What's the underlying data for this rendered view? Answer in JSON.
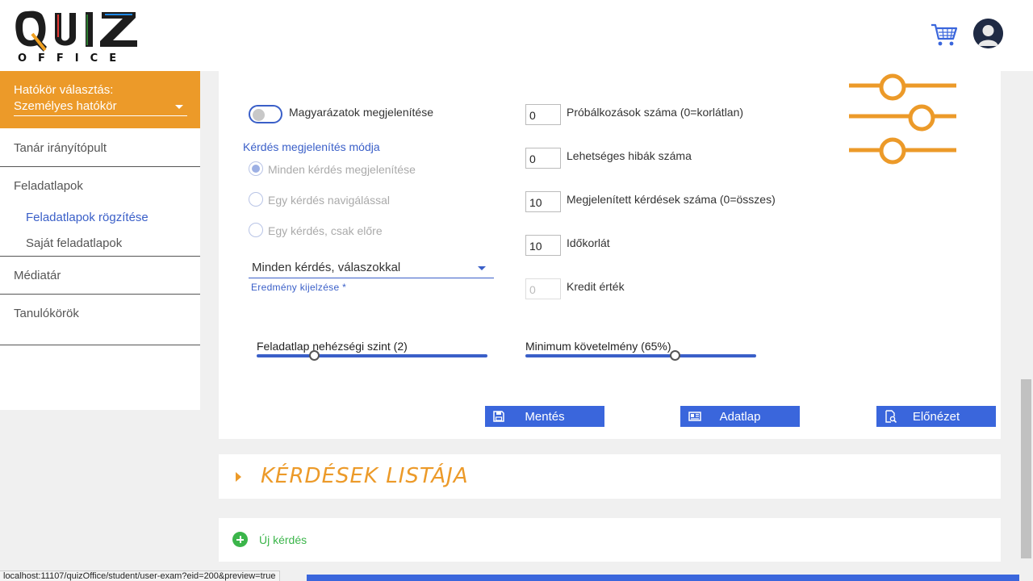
{
  "header": {
    "logo_text": "QUIZ",
    "logo_sub": "OFFICE",
    "cart_icon": "cart-icon",
    "avatar_icon": "user-avatar-icon"
  },
  "sidebar": {
    "scope_label": "Hatókör választás:",
    "scope_value": "Személyes hatókör",
    "items": [
      {
        "label": "Tanár irányítópult"
      },
      {
        "label": "Feladatlapok"
      },
      {
        "label": "Médiatár"
      },
      {
        "label": "Tanulókörök"
      }
    ],
    "subitems": [
      {
        "label": "Feladatlapok rögzítése",
        "active": true
      },
      {
        "label": "Saját feladatlapok",
        "active": false
      }
    ]
  },
  "settings": {
    "toggle_label": "Magyarázatok megjelenítése",
    "toggle_on": false,
    "display_mode_title": "Kérdés megjelenítés módja",
    "radios": [
      {
        "label": "Minden kérdés megjelenítése",
        "checked": true
      },
      {
        "label": "Egy kérdés navigálással",
        "checked": false
      },
      {
        "label": "Egy kérdés, csak előre",
        "checked": false
      }
    ],
    "result_select_value": "Minden kérdés, válaszokkal",
    "result_select_hint": "Eredmény kijelzése *",
    "fields": [
      {
        "value": "0",
        "label": "Próbálkozások száma (0=korlátlan)"
      },
      {
        "value": "0",
        "label": "Lehetséges hibák száma"
      },
      {
        "value": "10",
        "label": "Megjelenített kérdések száma (0=összes)"
      },
      {
        "value": "10",
        "label": "Időkorlát"
      },
      {
        "value": "0",
        "label": "Kredit érték",
        "disabled": true
      }
    ],
    "difficulty": {
      "label": "Feladatlap nehézségi szint (2)",
      "fraction": 0.25
    },
    "minimum": {
      "label": "Minimum követelmény (65%)",
      "fraction": 0.65
    }
  },
  "buttons": {
    "save": "Mentés",
    "datasheet": "Adatlap",
    "preview": "Előnézet"
  },
  "questions": {
    "title": "KÉRDÉSEK LISTÁJA",
    "new_question": "Új kérdés"
  },
  "statusbar": {
    "url": "localhost:11107/quizOffice/student/user-exam?eid=200&preview=true"
  },
  "colors": {
    "accent_orange": "#ec9a29",
    "accent_blue": "#3a66dc",
    "green": "#3bb54a"
  }
}
